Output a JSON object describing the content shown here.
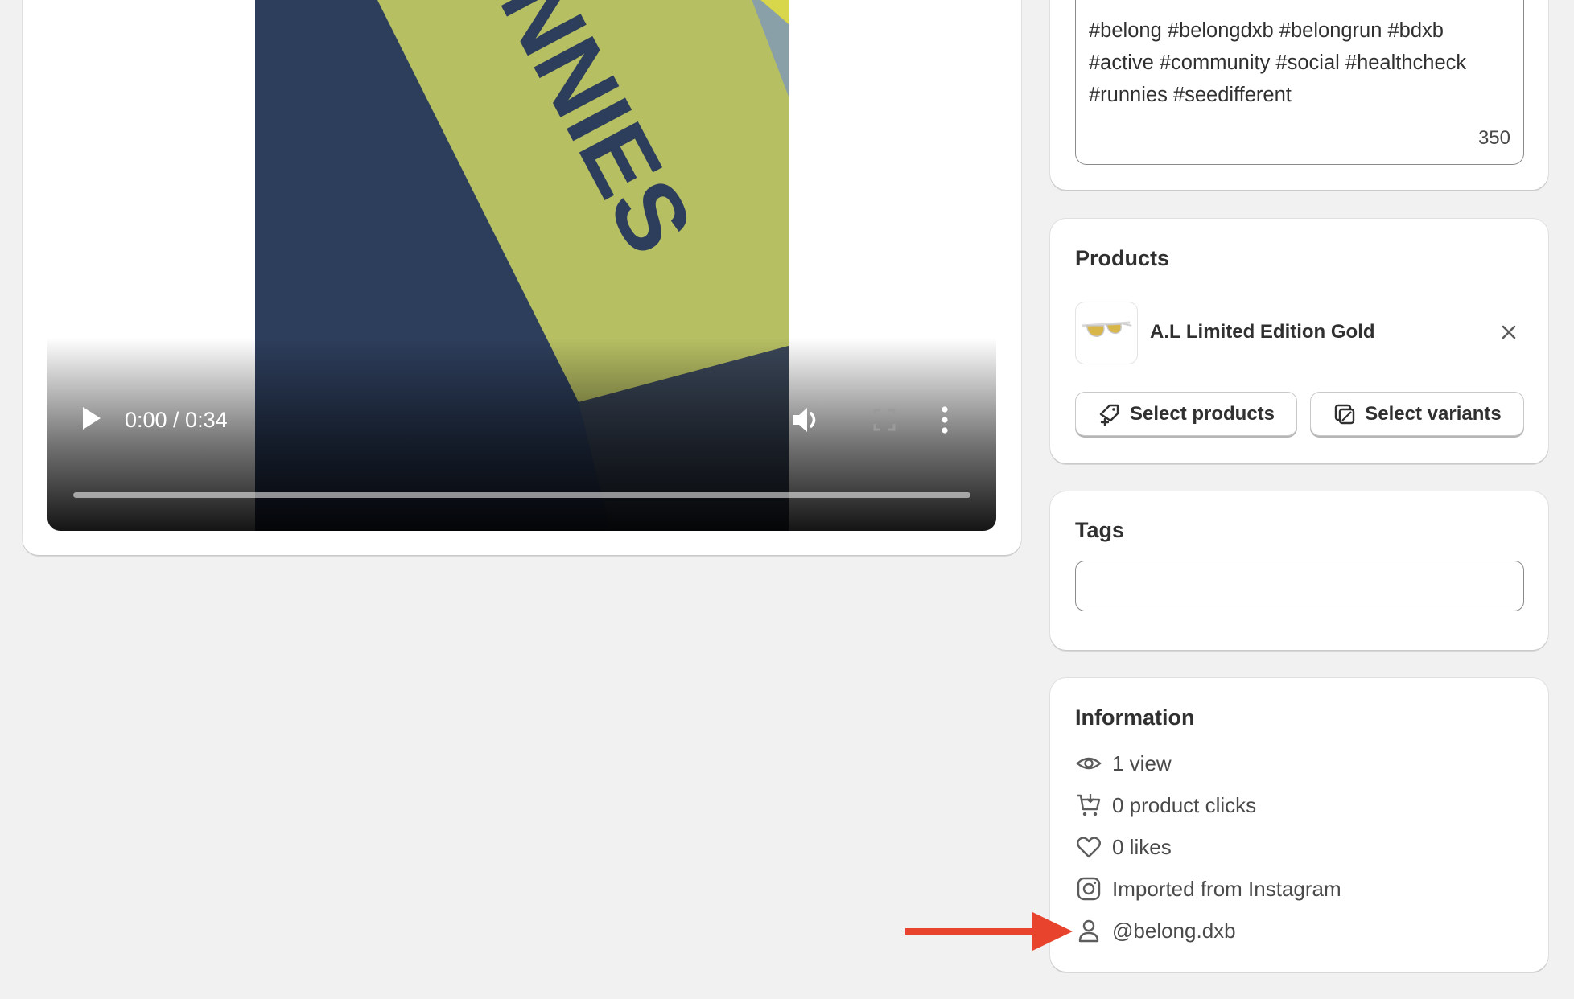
{
  "video": {
    "time": "0:00 / 0:34",
    "progress_fraction": 0.0,
    "frame_text": "NNIES"
  },
  "caption": {
    "text": "#belong #belongdxb #belongrun #bdxb\n#active #community #social #healthcheck\n#runnies #seedifferent",
    "remaining_chars": "350"
  },
  "products": {
    "title": "Products",
    "items": [
      {
        "name": "A.L Limited Edition Gold"
      }
    ],
    "select_products_label": "Select products",
    "select_variants_label": "Select variants"
  },
  "tags": {
    "title": "Tags",
    "value": "",
    "placeholder": ""
  },
  "information": {
    "title": "Information",
    "views": "1 view",
    "product_clicks": "0 product clicks",
    "likes": "0 likes",
    "source": "Imported from Instagram",
    "author": "@belong.dxb"
  },
  "icons": {
    "views": "eye-icon",
    "clicks": "cart-icon",
    "likes": "heart-icon",
    "source": "instagram-icon",
    "author": "person-icon"
  },
  "colors": {
    "page_bg": "#f1f1f1",
    "card_bg": "#ffffff",
    "text": "#303030",
    "annotation_arrow": "#e8432d"
  }
}
